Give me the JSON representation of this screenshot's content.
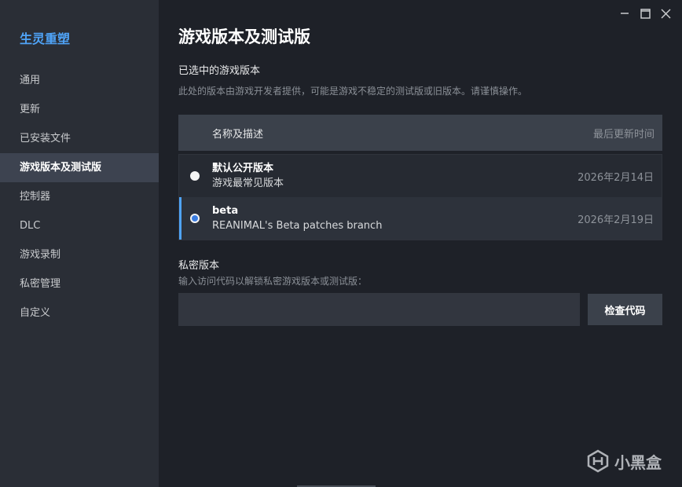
{
  "sidebar": {
    "game_title": "生灵重塑",
    "items": [
      {
        "label": "通用"
      },
      {
        "label": "更新"
      },
      {
        "label": "已安装文件"
      },
      {
        "label": "游戏版本及测试版"
      },
      {
        "label": "控制器"
      },
      {
        "label": "DLC"
      },
      {
        "label": "游戏录制"
      },
      {
        "label": "私密管理"
      },
      {
        "label": "自定义"
      }
    ]
  },
  "main": {
    "title": "游戏版本及测试版",
    "selected_section": {
      "title": "已选中的游戏版本",
      "description": "此处的版本由游戏开发者提供，可能是游戏不稳定的测试版或旧版本。请谨慎操作。"
    },
    "table": {
      "col_name": "名称及描述",
      "col_date": "最后更新时间",
      "rows": [
        {
          "name": "默认公开版本",
          "desc": "游戏最常见版本",
          "date": "2026年2月14日",
          "selected": false
        },
        {
          "name": "beta",
          "desc": "REANIMAL's Beta patches branch",
          "date": "2026年2月19日",
          "selected": true
        }
      ]
    },
    "private": {
      "title": "私密版本",
      "description": "输入访问代码以解锁私密游戏版本或测试版：",
      "input_value": "",
      "input_placeholder": "",
      "check_button": "检查代码"
    }
  },
  "watermark": {
    "text": "小黑盒"
  },
  "icons": [
    "minimize-icon",
    "maximize-icon",
    "close-icon",
    "heybox-logo-icon"
  ],
  "colors": {
    "accent": "#4fa3f7",
    "radio_selected": "#3b7de0"
  }
}
